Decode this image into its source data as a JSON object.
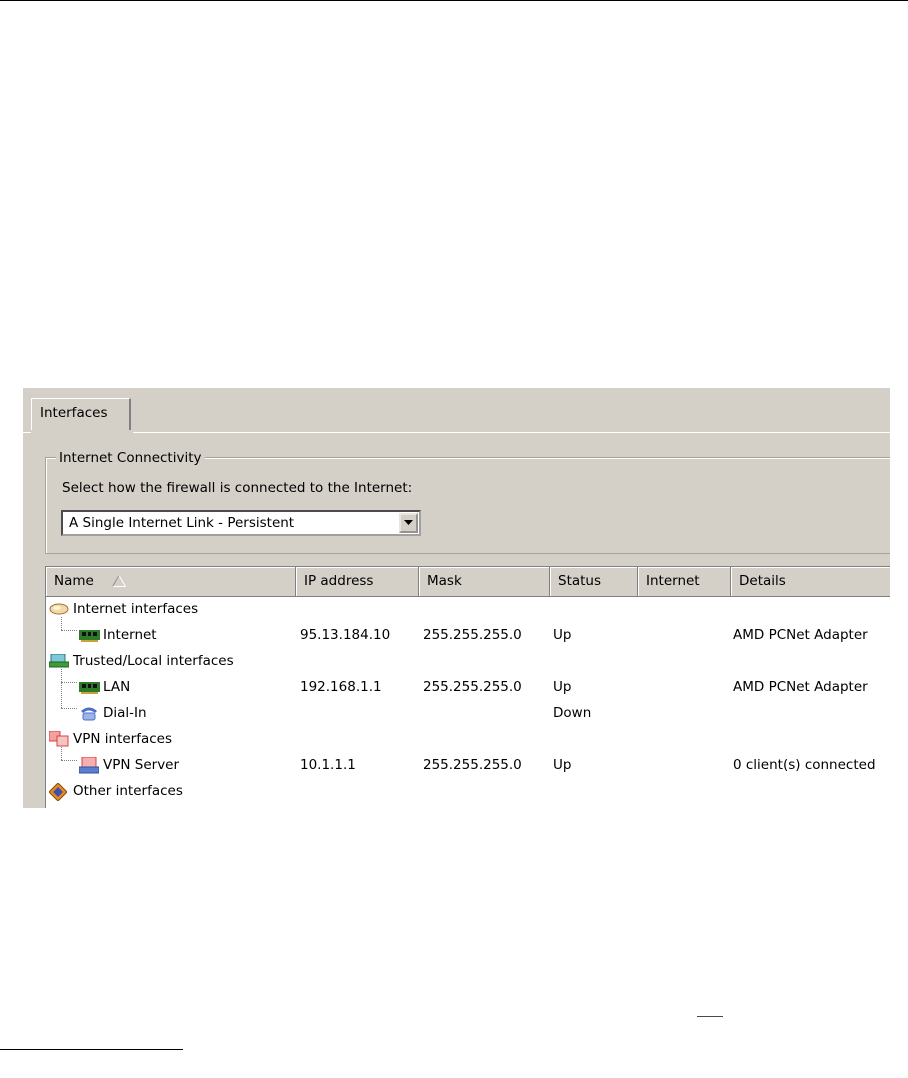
{
  "tab": {
    "label": "Interfaces"
  },
  "connectivity": {
    "group_title": "Internet Connectivity",
    "prompt": "Select how the firewall is connected to the Internet:",
    "selected": "A Single Internet Link - Persistent"
  },
  "table": {
    "columns": [
      "Name",
      "IP address",
      "Mask",
      "Status",
      "Internet",
      "Details"
    ],
    "groups": [
      {
        "name": "Internet interfaces",
        "icon": "cloud-icon",
        "children": [
          {
            "name": "Internet",
            "icon": "network-card-icon",
            "ip": "95.13.184.10",
            "mask": "255.255.255.0",
            "status": "Up",
            "internet": "",
            "details": "AMD PCNet Adapter"
          }
        ]
      },
      {
        "name": "Trusted/Local interfaces",
        "icon": "local-network-icon",
        "children": [
          {
            "name": "LAN",
            "icon": "network-card-icon",
            "ip": "192.168.1.1",
            "mask": "255.255.255.0",
            "status": "Up",
            "internet": "",
            "details": "AMD PCNet Adapter"
          },
          {
            "name": "Dial-In",
            "icon": "dialup-phone-icon",
            "ip": "",
            "mask": "",
            "status": "Down",
            "internet": "",
            "details": ""
          }
        ]
      },
      {
        "name": "VPN interfaces",
        "icon": "vpn-icon",
        "children": [
          {
            "name": "VPN Server",
            "icon": "vpn-server-icon",
            "ip": "10.1.1.1",
            "mask": "255.255.255.0",
            "status": "Up",
            "internet": "",
            "details": "0 client(s) connected"
          }
        ]
      },
      {
        "name": "Other interfaces",
        "icon": "other-interfaces-icon",
        "children": []
      }
    ]
  },
  "colors": {
    "panel": "#d4d0c8",
    "card_green": "#2f7a2a",
    "vpn_red": "#d94040",
    "phone_blue": "#4a6fc8"
  }
}
